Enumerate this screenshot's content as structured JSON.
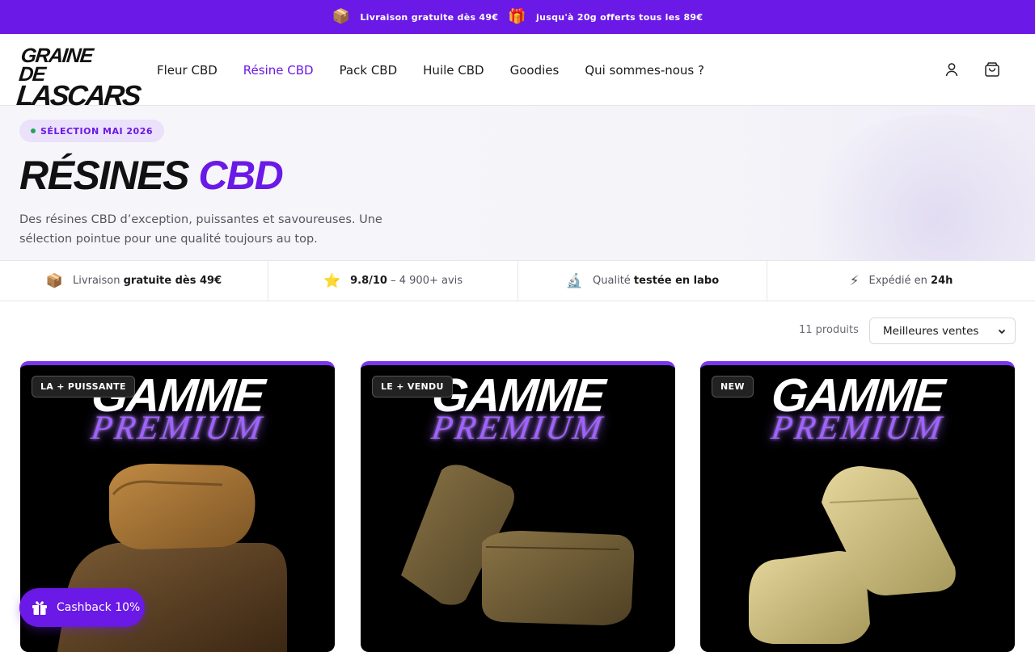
{
  "announcement": {
    "icon1": "package-icon",
    "text1": "Livraison gratuite dès 49€",
    "icon2": "gift-icon",
    "text2": "jusqu'à 20g offerts tous les 89€"
  },
  "header": {
    "logo_line1": "GRAINE DE",
    "logo_line2": "LASCARS",
    "nav": [
      "Fleur CBD",
      "Résine CBD",
      "Pack CBD",
      "Huile CBD",
      "Goodies",
      "Qui sommes-nous ?"
    ],
    "active_nav": "Résine CBD",
    "account_icon": "user-icon",
    "cart_icon": "shopping-bag-icon"
  },
  "hero": {
    "pill": "SÉLECTION MAI 2026",
    "title_1": "RÉSINES",
    "title_2": "CBD",
    "description": "Des résines CBD d’exception, puissantes et savoureuses. Une sélection pointue pour une qualité toujours au top."
  },
  "features": [
    {
      "icon": "package-icon",
      "emoji": "📦",
      "pre": "Livraison ",
      "bold": "gratuite dès 49€",
      "post": ""
    },
    {
      "icon": "star-icon",
      "emoji": "⭐",
      "pre": "",
      "bold": "9.8/10",
      "post": " – 4 900+ avis"
    },
    {
      "icon": "microscope-icon",
      "emoji": "🔬",
      "pre": "Qualité ",
      "bold": "testée en labo",
      "post": ""
    },
    {
      "icon": "lightning-icon",
      "emoji": "⚡",
      "pre": "Expédié en ",
      "bold": "24h",
      "post": ""
    }
  ],
  "toolbar": {
    "count": "11 produits",
    "sort_selected": "Meilleures ventes"
  },
  "products": [
    {
      "badge": "LA + PUISSANTE",
      "line1": "GAMME",
      "line2": "PREMIUM"
    },
    {
      "badge": "LE + VENDU",
      "line1": "GAMME",
      "line2": "PREMIUM"
    },
    {
      "badge": "NEW",
      "line1": "GAMME",
      "line2": "PREMIUM"
    }
  ],
  "cashback": {
    "icon": "gift-icon",
    "label": "Cashback 10%"
  },
  "colors": {
    "brand_purple": "#6a19e6",
    "pill_bg": "#ebe1fb",
    "dot_green": "#22a55a"
  }
}
